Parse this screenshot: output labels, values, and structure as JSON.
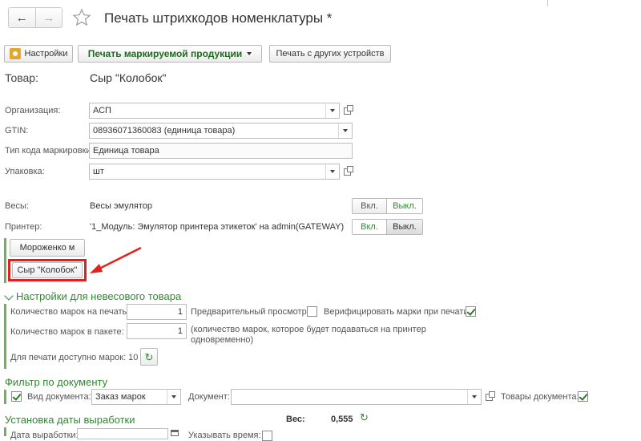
{
  "window": {
    "title": "Печать штрихкодов номенклатуры *",
    "star_icon": "star-icon"
  },
  "toolbar": {
    "settings_label": "Настройки",
    "print_marked_label": "Печать маркируемой продукции",
    "print_other_devices_label": "Печать с других устройств"
  },
  "product": {
    "label": "Товар:",
    "value": "Сыр \"Колобок\""
  },
  "form": {
    "organization_label": "Организация:",
    "organization_value": "АСП",
    "gtin_label": "GTIN:",
    "gtin_value": "08936071360083 (единица товара)",
    "code_type_label": "Тип кода маркировки:",
    "code_type_value": "Единица товара",
    "package_label": "Упаковка:",
    "package_value": "шт",
    "scales_label": "Весы:",
    "scales_value": "Весы эмулятор",
    "printer_label": "Принтер:",
    "printer_value": "'1_Модуль: Эмулятор принтера этикеток' на admin(GATEWAY)",
    "on_label": "Вкл.",
    "off_label": "Выкл."
  },
  "product_buttons": [
    {
      "label": "Мороженко м"
    },
    {
      "label": "Сыр \"Колобок\""
    }
  ],
  "non_weight": {
    "title": "Настройки для невесового товара",
    "marks_to_print_label": "Количество марок на печать:",
    "marks_to_print_value": "1",
    "preview_label": "Предварительный просмотр:",
    "preview_checked": false,
    "verify_label": "Верифицировать марки при печати:",
    "verify_checked": true,
    "marks_in_package_label": "Количество марок в пакете:",
    "marks_in_package_value": "1",
    "marks_in_package_note_line1": "(количество марок, которое будет подаваться на принтер",
    "marks_in_package_note_line2": "одновременно)",
    "available_label": "Для печати доступно марок: 10"
  },
  "filter": {
    "title": "Фильтр по документу",
    "doc_type_checked": true,
    "doc_type_label": "Вид документа:",
    "doc_type_value": "Заказ марок",
    "document_label": "Документ:",
    "document_value": "",
    "goods_label": "Товары документа:",
    "goods_checked": true
  },
  "production_date": {
    "title": "Установка даты выработки",
    "weight_label": "Вес:",
    "weight_value": "0,555",
    "date_label": "Дата выработки:",
    "specify_time_label": "Указывать время:"
  },
  "colors": {
    "accent_green": "#2e8b2e",
    "highlight_red": "#e32020"
  }
}
